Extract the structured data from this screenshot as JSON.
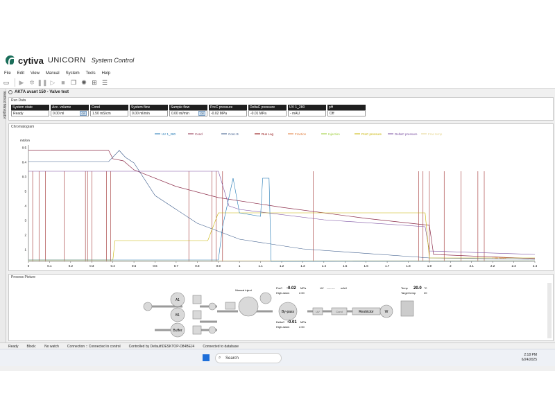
{
  "app": {
    "brand": "cytiva",
    "name": "UNICORN",
    "module": "System Control"
  },
  "menu": [
    "File",
    "Edit",
    "View",
    "Manual",
    "System",
    "Tools",
    "Help"
  ],
  "side_tab": "Method Navigator",
  "system_title": "AKTA avant 150 - Valve test",
  "run_data": {
    "title": "Run Data",
    "cells": [
      {
        "label": "System state",
        "value": "Ready",
        "ce": ""
      },
      {
        "label": "Acc. volume",
        "value": "0.00 ml",
        "ce": "CE"
      },
      {
        "label": "Cond",
        "value": "1.50 mS/cm",
        "ce": ""
      },
      {
        "label": "System flow",
        "value": "0.00 ml/min",
        "ce": ""
      },
      {
        "label": "Sample flow",
        "value": "0.00 ml/min",
        "ce": "CE"
      },
      {
        "label": "PreC pressure",
        "value": "-0.02 MPa",
        "ce": ""
      },
      {
        "label": "DeltaC pressure",
        "value": "-0.01 MPa",
        "ce": ""
      },
      {
        "label": "UV 1_280",
        "value": "- mAU",
        "ce": ""
      },
      {
        "label": "pH",
        "value": "Off",
        "ce": ""
      }
    ]
  },
  "chromatogram": {
    "title": "Chromatogram",
    "legend": [
      {
        "name": "UV 1_280",
        "color": "#1f77b4"
      },
      {
        "name": "Cond",
        "color": "#8c2d4a"
      },
      {
        "name": "Conc B",
        "color": "#3a5a8a"
      },
      {
        "name": "Run Log",
        "color": "#8b0000"
      },
      {
        "name": "Fraction",
        "color": "#e07b39"
      },
      {
        "name": "Injection",
        "color": "#9acd32"
      },
      {
        "name": "PreC pressure",
        "color": "#c8b400"
      },
      {
        "name": "DeltaC pressure",
        "color": "#7a4fa0"
      },
      {
        "name": "Frac temp",
        "color": "#e6d690"
      }
    ],
    "ylabel": "mS/cm",
    "yticks": [
      "0.5",
      "0.4",
      "0.3",
      "5",
      "4",
      "3",
      "2",
      "1"
    ],
    "xticks": [
      "0",
      "0.1",
      "0.2",
      "0.3",
      "0.4",
      "0.5",
      "0.6",
      "0.7",
      "0.8",
      "0.9",
      "1",
      "1.1",
      "1.2",
      "1.3",
      "1.4",
      "1.5",
      "1.6",
      "1.7",
      "1.8",
      "1.9",
      "2",
      "2.1",
      "2.2",
      "2.3",
      "2.4"
    ],
    "ann_end": "Frac waste"
  },
  "process": {
    "title": "Process Picture",
    "nodes": [
      "A1",
      "B1",
      "Buffer",
      "Manual inject",
      "By-pass",
      "Restrictor",
      "W",
      "UV",
      "Cond"
    ],
    "prec": {
      "label": "PreC",
      "value": "-0.02",
      "unit": "MPa",
      "alarm_label": "High alarm",
      "alarm": "2.00"
    },
    "deltac": {
      "label": "DeltaC",
      "value": "-0.01",
      "unit": "MPa",
      "alarm_label": "High alarm",
      "alarm": "2.00"
    },
    "uv": {
      "label": "UV",
      "value": "-----.---",
      "unit": "mAU"
    },
    "temp": {
      "label": "Temp",
      "value": "20.0",
      "unit": "°C",
      "target_label": "Target temp",
      "target": "20"
    }
  },
  "status": {
    "state": "Ready",
    "block": "Block:",
    "watch": "No watch",
    "connection": "Connection :: Connected in control",
    "controlled": "Controlled by Default\\DESKTOP-D84BEJ4",
    "db": "Connected to database"
  },
  "taskbar": {
    "search": "Search",
    "time": "2:18 PM",
    "date": "6/24/2025"
  }
}
